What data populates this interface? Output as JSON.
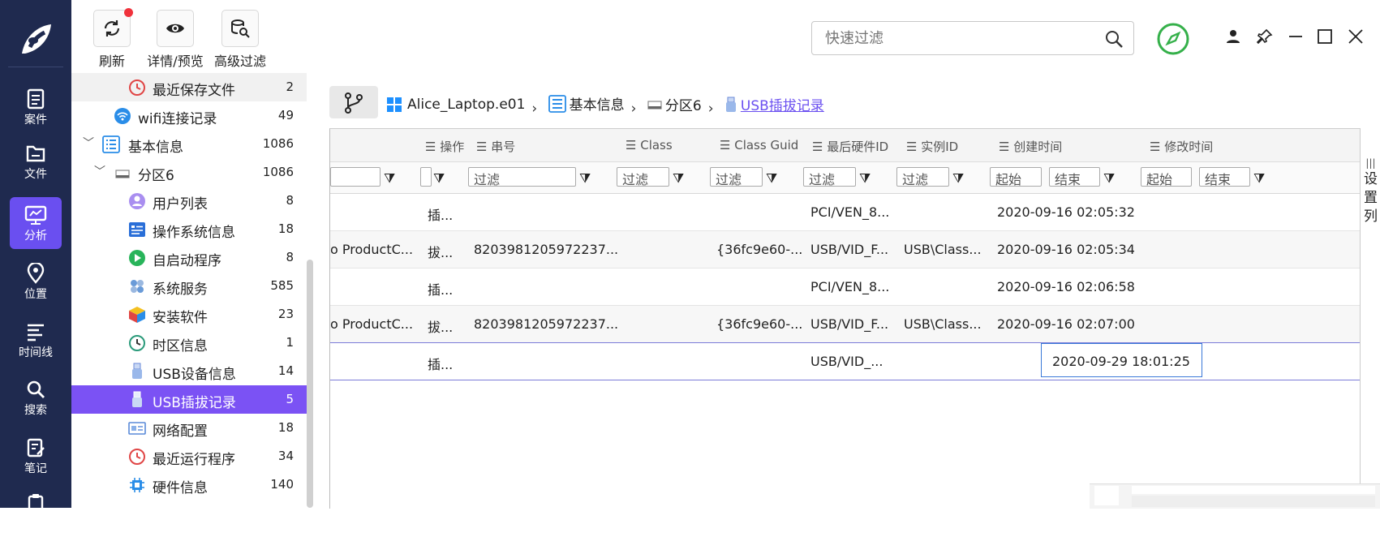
{
  "toolbar": {
    "refresh_label": "刷新",
    "preview_label": "详情/预览",
    "advanced_filter_label": "高级过滤"
  },
  "search": {
    "placeholder": "快速过滤"
  },
  "nav": [
    {
      "label": "案件",
      "icon": "case-icon"
    },
    {
      "label": "文件",
      "icon": "file-icon"
    },
    {
      "label": "分析",
      "icon": "analysis-icon",
      "active": true
    },
    {
      "label": "位置",
      "icon": "location-icon"
    },
    {
      "label": "时间线",
      "icon": "timeline-icon"
    },
    {
      "label": "搜索",
      "icon": "search-icon"
    },
    {
      "label": "笔记",
      "icon": "notes-icon"
    }
  ],
  "tree": [
    {
      "label": "最近保存文件",
      "count": "2",
      "icon": "clock-icon"
    },
    {
      "label": "wifi连接记录",
      "count": "49",
      "icon": "wifi-icon"
    },
    {
      "label": "基本信息",
      "count": "1086",
      "icon": "list-icon"
    },
    {
      "label": "分区6",
      "count": "1086",
      "icon": "drive-icon"
    },
    {
      "label": "用户列表",
      "count": "8",
      "icon": "user-icon"
    },
    {
      "label": "操作系统信息",
      "count": "18",
      "icon": "os-icon"
    },
    {
      "label": "自启动程序",
      "count": "8",
      "icon": "play-icon"
    },
    {
      "label": "系统服务",
      "count": "585",
      "icon": "service-icon"
    },
    {
      "label": "安装软件",
      "count": "23",
      "icon": "package-icon"
    },
    {
      "label": "时区信息",
      "count": "1",
      "icon": "timezone-icon"
    },
    {
      "label": "USB设备信息",
      "count": "14",
      "icon": "usb-icon"
    },
    {
      "label": "USB插拔记录",
      "count": "5",
      "icon": "usb-icon"
    },
    {
      "label": "网络配置",
      "count": "18",
      "icon": "network-icon"
    },
    {
      "label": "最近运行程序",
      "count": "34",
      "icon": "clock-icon"
    },
    {
      "label": "硬件信息",
      "count": "140",
      "icon": "chip-icon"
    }
  ],
  "breadcrumb": {
    "device": "Alice_Laptop.e01",
    "basic": "基本信息",
    "partition": "分区6",
    "current": "USB插拔记录"
  },
  "grid": {
    "columns": [
      "操作",
      "串号",
      "Class",
      "Class Guid",
      "最后硬件ID",
      "实例ID",
      "创建时间",
      "修改时间"
    ],
    "filter_placeholder": "过滤",
    "range_start": "起始",
    "range_end": "结束",
    "settings_label": "设置列",
    "rows": [
      {
        "name": "",
        "op": "插...",
        "serial": "",
        "cls": "",
        "guid": "",
        "hwid": "PCI/VEN_8...",
        "inst": "",
        "created": "2020-09-16 02:05:32",
        "modified": ""
      },
      {
        "name": "o ProductC...",
        "op": "拔...",
        "serial": "8203981205972237...",
        "cls": "",
        "guid": "{36fc9e60-...",
        "hwid": "USB/VID_F...",
        "inst": "USB\\Class...",
        "created": "2020-09-16 02:05:34",
        "modified": ""
      },
      {
        "name": "",
        "op": "插...",
        "serial": "",
        "cls": "",
        "guid": "",
        "hwid": "PCI/VEN_8...",
        "inst": "",
        "created": "2020-09-16 02:06:58",
        "modified": ""
      },
      {
        "name": "o ProductC...",
        "op": "拔...",
        "serial": "8203981205972237...",
        "cls": "",
        "guid": "{36fc9e60-...",
        "hwid": "USB/VID_F...",
        "inst": "USB\\Class...",
        "created": "2020-09-16 02:07:00",
        "modified": ""
      },
      {
        "name": "",
        "op": "插...",
        "serial": "",
        "cls": "",
        "guid": "",
        "hwid": "USB/VID_...",
        "inst": "",
        "created": "2020-09-29 18:01:25",
        "modified": ""
      }
    ]
  },
  "colors": {
    "accent": "#7b52f4",
    "rail": "#1f2a4f",
    "link": "#6a4ff0",
    "badge": "#f0323c",
    "pin_green": "#35b04a"
  }
}
